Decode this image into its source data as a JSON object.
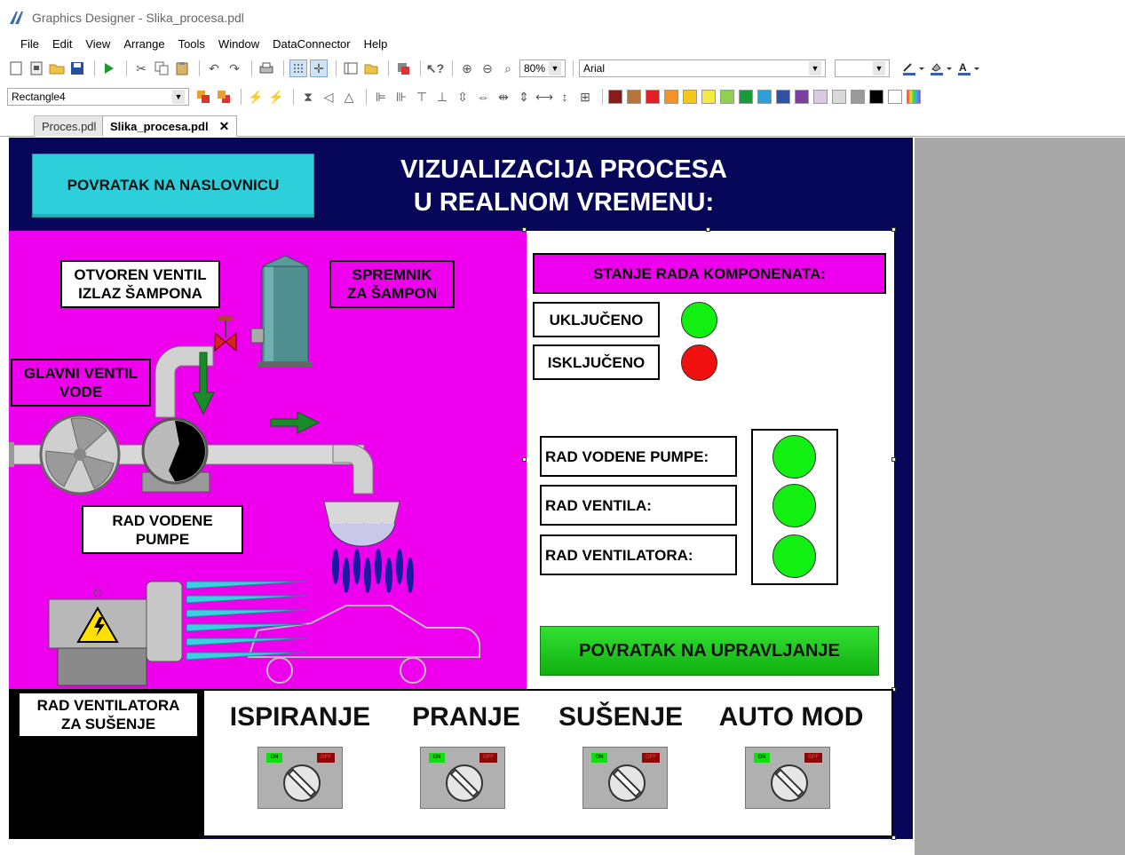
{
  "window": {
    "title": "Graphics Designer - Slika_procesa.pdl"
  },
  "menu": [
    "File",
    "Edit",
    "View",
    "Arrange",
    "Tools",
    "Window",
    "DataConnector",
    "Help"
  ],
  "toolbar": {
    "zoom": "80%",
    "font": "Arial",
    "object_selector": "Rectangle4"
  },
  "palette": [
    "#8b1a1a",
    "#b8733b",
    "#e31e24",
    "#f39326",
    "#f5c518",
    "#f5e94a",
    "#8fd14f",
    "#1a9a3a",
    "#2e9ed6",
    "#2f52a3",
    "#7b3f9e",
    "#d9c9e3",
    "#d9d9d9",
    "#9a9a9a",
    "#000000",
    "#ffffff",
    "#c040c0"
  ],
  "tabs": [
    {
      "label": "Proces.pdl"
    },
    {
      "label": "Slika_procesa.pdl"
    }
  ],
  "screen": {
    "header_button": "POVRATAK NA NASLOVNICU",
    "title_line1": "VIZUALIZACIJA PROCESA",
    "title_line2": "U REALNOM VREMENU:",
    "labels": {
      "valve_out_1": "OTVOREN VENTIL",
      "valve_out_2": "IZLAZ ŠAMPONA",
      "tank_1": "SPREMNIK",
      "tank_2": "ZA ŠAMPON",
      "main_valve_1": "GLAVNI VENTIL",
      "main_valve_2": "VODE",
      "pump_1": "RAD VODENE",
      "pump_2": "PUMPE",
      "fan_1": "RAD VENTILATORA",
      "fan_2": "ZA SUŠENJE"
    },
    "status": {
      "header": "STANJE RADA KOMPONENATA:",
      "on": "UKLJUČENO",
      "off": "ISKLJUČENO",
      "rows": [
        {
          "label": "RAD VODENE PUMPE:"
        },
        {
          "label": "RAD VENTILA:"
        },
        {
          "label": "RAD VENTILATORA:"
        }
      ]
    },
    "control_button": "POVRATAK NA UPRAVLJANJE",
    "modes": [
      {
        "label": "ISPIRANJE",
        "on": "ON",
        "off": "OFF"
      },
      {
        "label": "PRANJE",
        "on": "ON",
        "off": "OFF"
      },
      {
        "label": "SUŠENJE",
        "on": "ON",
        "off": "OFF"
      },
      {
        "label": "AUTO MOD",
        "on": "ON",
        "off": "OFF"
      }
    ]
  }
}
